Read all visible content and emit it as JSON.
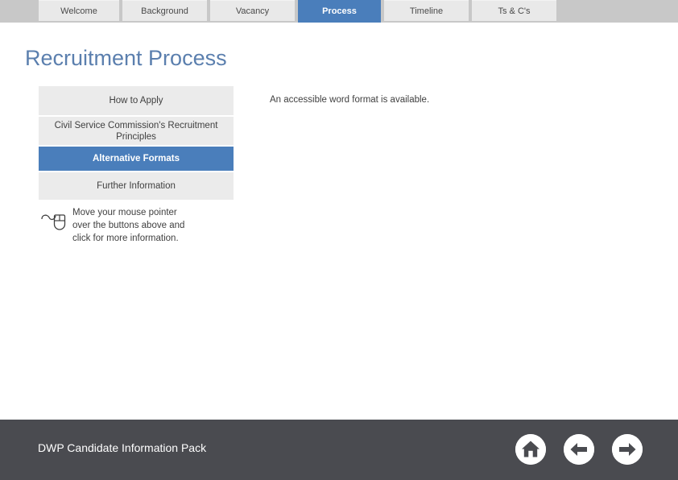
{
  "navtabs": {
    "items": [
      {
        "label": "Welcome",
        "active": false
      },
      {
        "label": "Background",
        "active": false
      },
      {
        "label": "Vacancy",
        "active": false
      },
      {
        "label": "Process",
        "active": true
      },
      {
        "label": "Timeline",
        "active": false
      },
      {
        "label": "Ts & C's",
        "active": false
      }
    ]
  },
  "page": {
    "title": "Recruitment Process",
    "title_color": "#5b7fae"
  },
  "menu": {
    "accent_color": "#4a7ebb",
    "items": [
      {
        "label": "How to Apply",
        "selected": false
      },
      {
        "label": "Civil Service Commission's Recruitment Principles",
        "selected": false
      },
      {
        "label": "Alternative Formats",
        "selected": true
      },
      {
        "label": "Further Information",
        "selected": false
      }
    ]
  },
  "hint": {
    "icon": "mouse-icon",
    "text": "Move your mouse pointer\nover the buttons above and\nclick for more information."
  },
  "content": {
    "body_text": "An accessible word format is available."
  },
  "footer": {
    "title": "DWP Candidate Information Pack",
    "background_color": "#4a4b50",
    "nav": [
      {
        "name": "home-icon",
        "label": "Home"
      },
      {
        "name": "back-arrow-icon",
        "label": "Back"
      },
      {
        "name": "forward-arrow-icon",
        "label": "Forward"
      }
    ]
  }
}
